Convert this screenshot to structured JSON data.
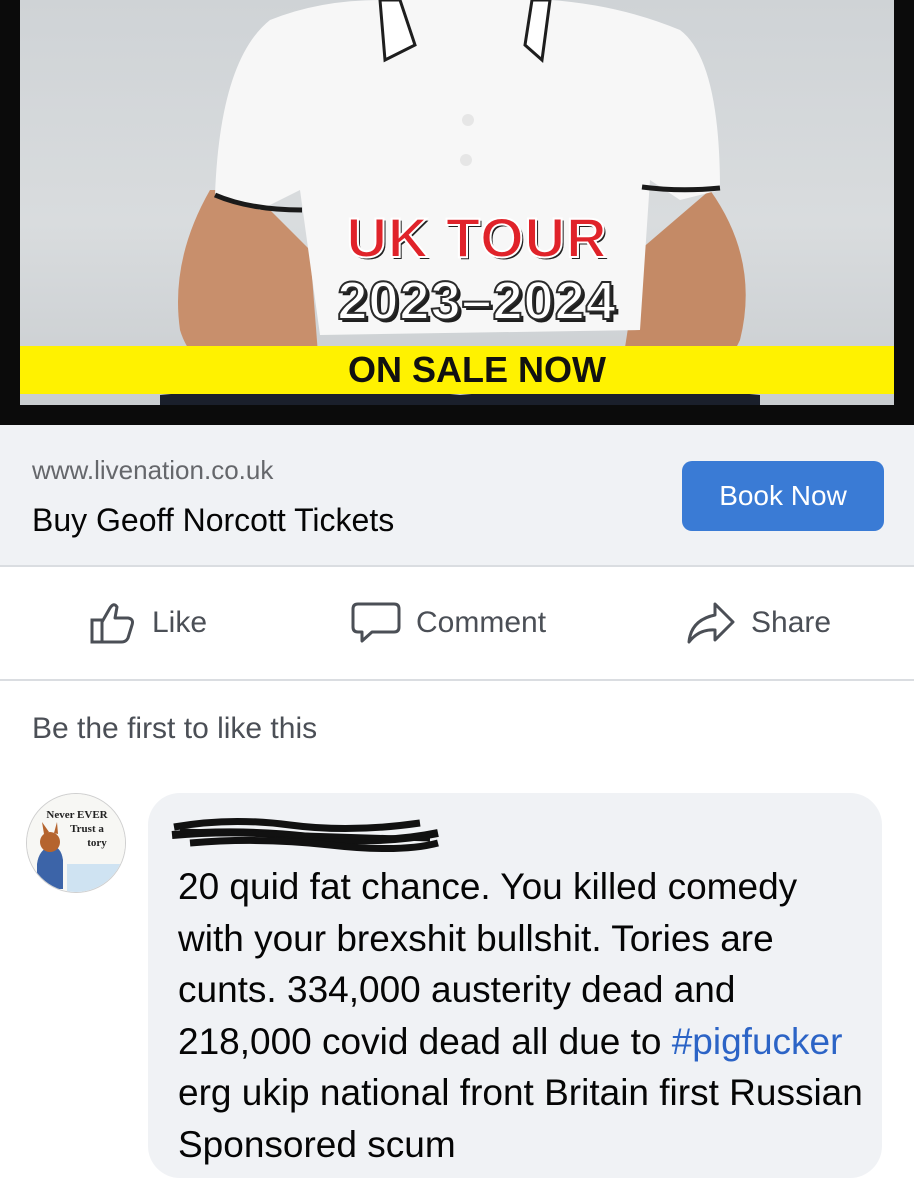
{
  "ad": {
    "tour_title": "UK TOUR",
    "tour_years": "2023–2024",
    "sale_banner": "ON SALE NOW"
  },
  "link": {
    "url": "www.livenation.co.uk",
    "title": "Buy Geoff Norcott Tickets",
    "button_label": "Book Now",
    "button_color": "#3a7bd5"
  },
  "actions": {
    "like_label": "Like",
    "comment_label": "Comment",
    "share_label": "Share"
  },
  "reactions_summary": "Be the first to like this",
  "comment": {
    "avatar_text": [
      "Never EVER",
      "Trust a",
      "tory"
    ],
    "author_redacted": true,
    "text_before": "20 quid fat chance. You killed comedy with your brexshit bullshit. Tories are cunts. 334,000 austerity dead and 218,000 covid dead all due to ",
    "hashtag": "#pigfucker",
    "text_after": " erg ukip national front Britain first Russian Sponsored scum",
    "hashtag_color": "#2c64c6"
  }
}
